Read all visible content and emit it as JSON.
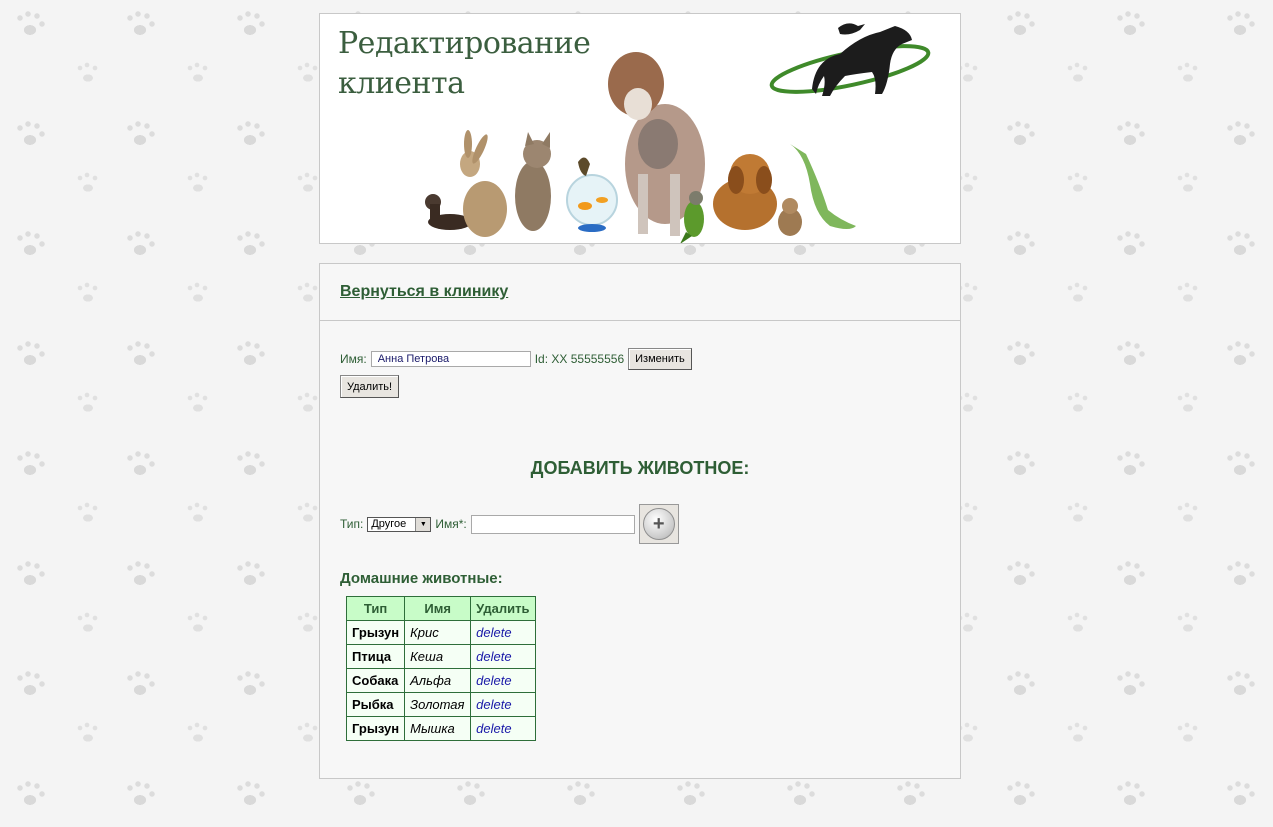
{
  "header": {
    "title": "Редактирование клиента"
  },
  "nav": {
    "back_link": "Вернуться в клинику"
  },
  "client": {
    "name_label": "Имя:",
    "name_value": "Анна Петрова",
    "id_text": "Id: XX 55555556",
    "change_button": "Изменить",
    "delete_button": "Удалить!"
  },
  "add_pet": {
    "title": "ДОБАВИТЬ ЖИВОТНОЕ:",
    "type_label": "Тип:",
    "type_selected": "Другое",
    "name_label": "Имя*:",
    "name_value": "",
    "add_icon": "plus-icon"
  },
  "pets": {
    "title": "Домашние животные:",
    "columns": [
      "Тип",
      "Имя",
      "Удалить"
    ],
    "rows": [
      {
        "type": "Грызун",
        "name": "Крис",
        "action": "delete"
      },
      {
        "type": "Птица",
        "name": "Кеша",
        "action": "delete"
      },
      {
        "type": "Собака",
        "name": "Альфа",
        "action": "delete"
      },
      {
        "type": "Рыбка",
        "name": "Золотая",
        "action": "delete"
      },
      {
        "type": "Грызун",
        "name": "Мышка",
        "action": "delete"
      }
    ]
  },
  "colors": {
    "accent_green": "#2e5e35",
    "header_green": "#c8fcc8",
    "link_blue": "#1a1aa8"
  }
}
